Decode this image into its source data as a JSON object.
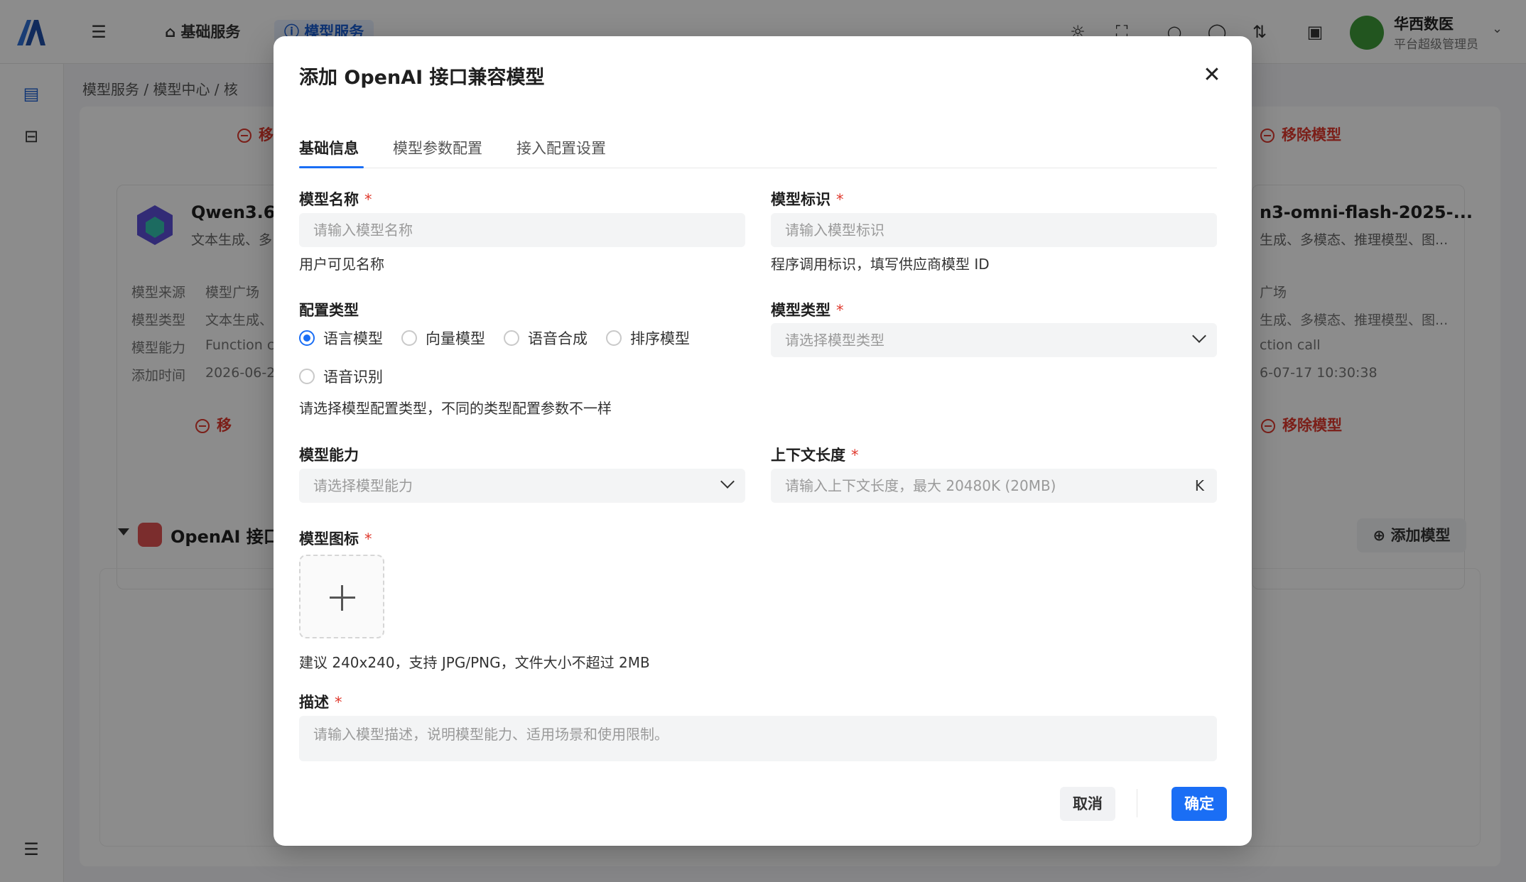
{
  "colors": {
    "accent": "#1a6ef5",
    "danger": "#e03a2e",
    "required": "#e03a2e"
  },
  "topbar": {
    "nav_tabs": [
      {
        "label": "基础服务",
        "icon": "home-icon"
      },
      {
        "label": "模型服务",
        "icon": "info-icon"
      }
    ],
    "user": {
      "name": "华西数医",
      "role": "平台超级管理员"
    }
  },
  "breadcrumb": [
    "模型服务",
    "模型中心",
    "核"
  ],
  "background": {
    "card_left": {
      "title": "Qwen3.6-",
      "subtitle": "文本生成、多",
      "rows": [
        {
          "key": "模型来源",
          "value": "模型广场"
        },
        {
          "key": "模型类型",
          "value": "文本生成、"
        },
        {
          "key": "模型能力",
          "value": "Function c"
        },
        {
          "key": "添加时间",
          "value": "2026-06-2"
        }
      ],
      "remove_label": "移"
    },
    "card_right": {
      "title": "n3-omni-flash-2025-...",
      "subtitle": "生成、多模态、推理模型、图...",
      "rows": [
        "广场",
        "生成、多模态、推理模型、图...",
        "ction call",
        "6-07-17 10:30:38"
      ],
      "remove_label": "移除模型"
    },
    "group": {
      "title": "OpenAI 接口",
      "add_button": "添加模型"
    }
  },
  "modal": {
    "title": "添加 OpenAI 接口兼容模型",
    "tabs": [
      "基础信息",
      "模型参数配置",
      "接入配置设置"
    ],
    "active_tab": 0,
    "fields": {
      "model_name": {
        "label": "模型名称",
        "placeholder": "请输入模型名称",
        "help": "用户可见名称",
        "required": true
      },
      "model_id": {
        "label": "模型标识",
        "placeholder": "请输入模型标识",
        "help": "程序调用标识，填写供应商模型 ID",
        "required": true
      },
      "config_type": {
        "label": "配置类型",
        "options": [
          "语言模型",
          "向量模型",
          "语音合成",
          "排序模型",
          "语音识别"
        ],
        "selected": "语言模型",
        "help": "请选择模型配置类型，不同的类型配置参数不一样"
      },
      "model_type": {
        "label": "模型类型",
        "placeholder": "请选择模型类型",
        "required": true
      },
      "capability": {
        "label": "模型能力",
        "placeholder": "请选择模型能力"
      },
      "context_length": {
        "label": "上下文长度",
        "placeholder": "请输入上下文长度，最大 20480K (20MB)",
        "suffix": "K",
        "required": true
      },
      "icon": {
        "label": "模型图标",
        "help": "建议 240x240，支持 JPG/PNG，文件大小不超过 2MB",
        "required": true
      },
      "description": {
        "label": "描述",
        "placeholder": "请输入模型描述，说明模型能力、适用场景和使用限制。",
        "required": true
      }
    },
    "buttons": {
      "cancel": "取消",
      "ok": "确定"
    }
  }
}
